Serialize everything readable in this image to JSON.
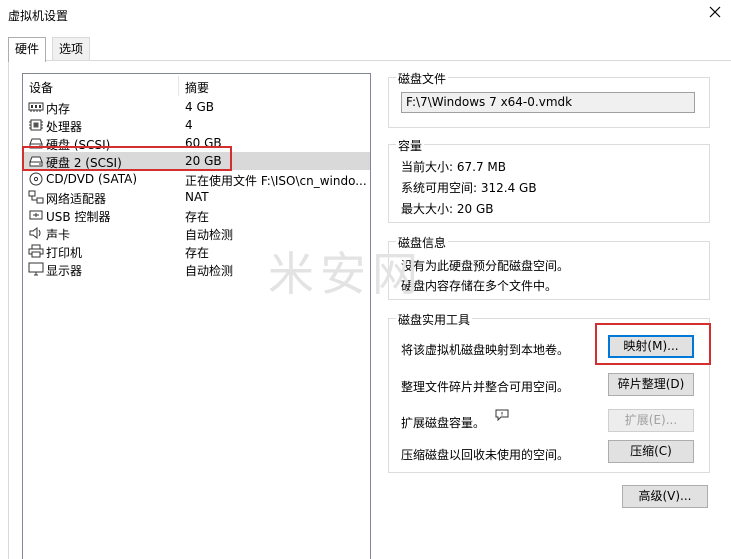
{
  "window": {
    "title": "虚拟机设置"
  },
  "tabs": [
    {
      "label": "硬件",
      "active": true
    },
    {
      "label": "选项",
      "active": false
    }
  ],
  "device_list": {
    "headers": {
      "device": "设备",
      "summary": "摘要"
    },
    "rows": [
      {
        "name": "内存",
        "summary": "4 GB",
        "icon": "memory-icon"
      },
      {
        "name": "处理器",
        "summary": "4",
        "icon": "cpu-icon"
      },
      {
        "name": "硬盘 (SCSI)",
        "summary": "60 GB",
        "icon": "harddisk-icon"
      },
      {
        "name": "硬盘 2 (SCSI)",
        "summary": "20 GB",
        "icon": "harddisk-icon",
        "selected": true
      },
      {
        "name": "CD/DVD (SATA)",
        "summary": "正在使用文件 F:\\ISO\\cn_windo...",
        "icon": "cdrom-icon"
      },
      {
        "name": "网络适配器",
        "summary": "NAT",
        "icon": "network-icon"
      },
      {
        "name": "USB 控制器",
        "summary": "存在",
        "icon": "usb-icon"
      },
      {
        "name": "声卡",
        "summary": "自动检测",
        "icon": "speaker-icon"
      },
      {
        "name": "打印机",
        "summary": "存在",
        "icon": "printer-icon"
      },
      {
        "name": "显示器",
        "summary": "自动检测",
        "icon": "monitor-icon"
      }
    ]
  },
  "disk_file": {
    "title": "磁盘文件",
    "path": "F:\\7\\Windows 7 x64-0.vmdk"
  },
  "capacity": {
    "title": "容量",
    "current_size": "当前大小: 67.7 MB",
    "free_space": "系统可用空间: 312.4 GB",
    "max_size": "最大大小: 20 GB"
  },
  "disk_info": {
    "title": "磁盘信息",
    "line1": "没有为此硬盘预分配磁盘空间。",
    "line2": "硬盘内容存储在多个文件中。"
  },
  "utilities": {
    "title": "磁盘实用工具",
    "map_desc": "将该虚拟机磁盘映射到本地卷。",
    "map_label": "映射(M)...",
    "defrag_desc": "整理文件碎片并整合可用空间。",
    "defrag_label": "碎片整理(D)",
    "expand_desc": "扩展磁盘容量。",
    "expand_label": "扩展(E)...",
    "compact_desc": "压缩磁盘以回收未使用的空间。",
    "compact_label": "压缩(C)"
  },
  "advanced_label": "高级(V)...",
  "watermark": "米安网",
  "colors": {
    "highlight": "#d32f2f",
    "selection": "#d9d9d9",
    "focus": "#0078d7"
  }
}
